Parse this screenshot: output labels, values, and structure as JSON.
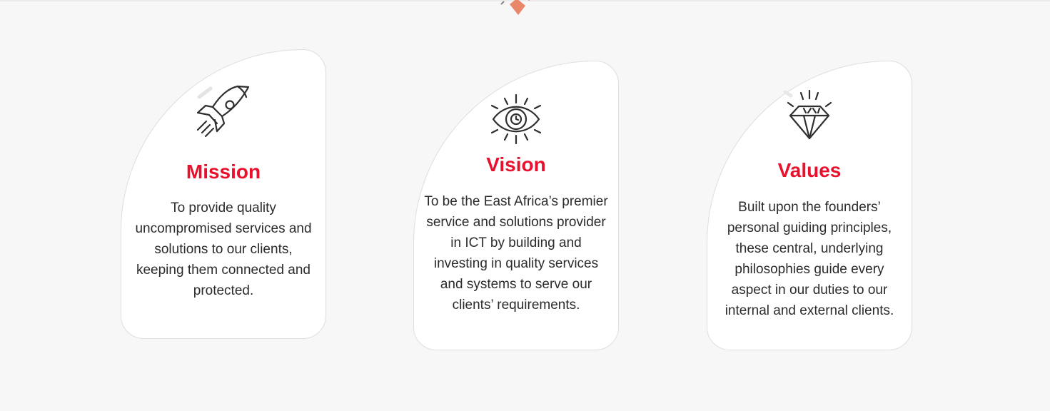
{
  "colors": {
    "accent": "#e8112d",
    "background": "#f7f7f7",
    "card": "#ffffff",
    "text": "#2b2b2b",
    "deco": "#e9876a"
  },
  "cards": [
    {
      "icon": "rocket-icon",
      "title": "Mission",
      "text": "To provide quality uncompromised services and solutions to our clients, keeping them connected and protected."
    },
    {
      "icon": "eye-icon",
      "title": "Vision",
      "text": "To be the East Africa’s premier service and solutions provider in ICT by building and investing in quality services and systems to serve our clients’ requirements."
    },
    {
      "icon": "diamond-icon",
      "title": "Values",
      "text": "Built upon the founders’ personal guiding principles, these central, underlying philosophies guide every aspect in our duties to our internal and external clients."
    }
  ]
}
